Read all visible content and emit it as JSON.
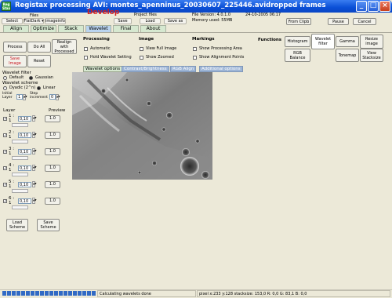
{
  "window": {
    "title": "Registax processing AVI: montes_apenninus_20030607_225446.avidropped frames",
    "app_icon_text": "Reg Stax",
    "minimize": "_",
    "maximize": "□",
    "close": "×"
  },
  "header": {
    "files_label": "Files",
    "files_value": "FlatDark ▾",
    "imageinfo": "imageinfo",
    "select": "Select",
    "develop": "Develop",
    "save": "Save",
    "project_files_label": "Project files",
    "load": "Load",
    "save_as": "Save as",
    "file_version": "File Version: 4.0.1.0",
    "date": "24-10-2005 06:17",
    "memory": "Memory used: 55MB",
    "from_clipb": "From Clipb",
    "pause": "Pause",
    "cancel": "Cancel"
  },
  "main_tabs": [
    "Align",
    "Optimize",
    "Stack",
    "Wavelet",
    "Final",
    "About"
  ],
  "left_buttons": {
    "process": "Process",
    "do_all": "Do All",
    "realign": "Realign with Processed",
    "save_image": "Save Image",
    "reset": "Reset"
  },
  "processing": {
    "title": "Processing",
    "automatic": "Automatic",
    "hold_wavelet": "Hold Wavelet Setting"
  },
  "image_section": {
    "title": "Image",
    "view_full": "View Full Image",
    "show_zoomed": "Show Zoomed"
  },
  "markings": {
    "title": "Markings",
    "show_processing_area": "Show Processing Area",
    "show_alignment_points": "Show Alignment Points"
  },
  "functions": {
    "title": "Functions",
    "histogram": "Histogram",
    "wavelet_filter": "Wavelet filter",
    "gamma": "Gamma",
    "resize_image": "Resize image",
    "rgb_balance": "RGB Balance",
    "tonemap": "Tonemap",
    "view_stacksize": "View Stacksize"
  },
  "subtabs": [
    "Wavelet options",
    "Contrast/Brightness",
    "RGB Align",
    "Additional options"
  ],
  "wavelet_filter": {
    "title": "Wavelet filter",
    "default": "Default",
    "gaussian": "Gaussian",
    "scheme_title": "Wavelet scheme",
    "dyadic": "Dyadic (2^n)",
    "linear": "Linear",
    "initial_layer_label": "Initial Layer",
    "initial_layer": "1",
    "step_increment_label": "Step increment",
    "step_increment": "0"
  },
  "layers": {
    "layer_header": "Layer",
    "preview_header": "Preview",
    "rows": [
      {
        "label": "1 : 1",
        "value": "0,10",
        "preview": "1.0"
      },
      {
        "label": "2 : 1",
        "value": "0,10",
        "preview": "1.0"
      },
      {
        "label": "3 : 1",
        "value": "0,10",
        "preview": "1.0"
      },
      {
        "label": "4 : 1",
        "value": "0,10",
        "preview": "1.0"
      },
      {
        "label": "5 : 1",
        "value": "0,10",
        "preview": "1.0"
      },
      {
        "label": "6 : 1",
        "value": "0,10",
        "preview": "1.0"
      }
    ],
    "load_scheme": "Load Scheme",
    "save_scheme": "Save Scheme"
  },
  "status": {
    "progress_blocks": 20,
    "message": "Calculating wavelets done",
    "pixel_info": "pixel x:233 y:128 stacksize: 153,0 R: 0,0 G: 83,1 B: 0,0"
  }
}
